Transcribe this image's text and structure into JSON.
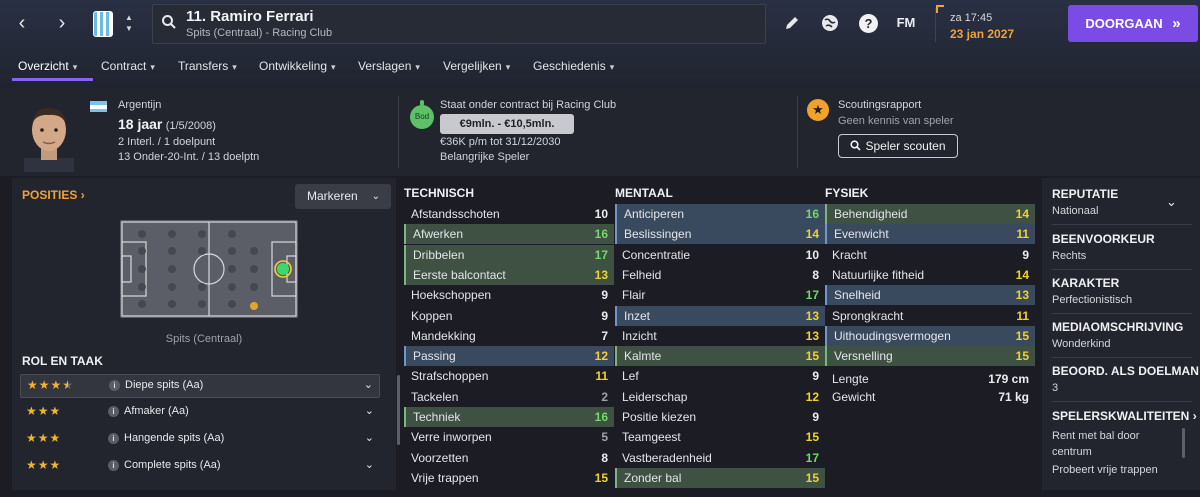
{
  "player": {
    "name": "11. Ramiro Ferrari",
    "subtitle": "Spits (Centraal) - Racing Club"
  },
  "header": {
    "time": "za 17:45",
    "date": "23 jan 2027",
    "continue_label": "DOORGAAN",
    "continue_icon": "»",
    "fm_label": "FM",
    "help_label": "?"
  },
  "tabs": [
    {
      "label": "Overzicht"
    },
    {
      "label": "Contract"
    },
    {
      "label": "Transfers"
    },
    {
      "label": "Ontwikkeling"
    },
    {
      "label": "Verslagen"
    },
    {
      "label": "Vergelijken"
    },
    {
      "label": "Geschiedenis"
    }
  ],
  "bio": {
    "nationality": "Argentijn",
    "age": "18 jaar",
    "dob": "(1/5/2008)",
    "caps": "2 Interl. / 1 doelpunt",
    "youth_caps": "13 Onder-20-Int. / 13 doelptn"
  },
  "contract": {
    "title": "Staat onder contract bij Racing Club",
    "bid_label": "Bod",
    "value_range": "€9mln. - €10,5mln.",
    "wage": "€36K p/m tot 31/12/2030",
    "status": "Belangrijke Speler"
  },
  "scouting": {
    "title": "Scoutingsrapport",
    "subtitle": "Geen kennis van speler",
    "button": "Speler scouten"
  },
  "positions": {
    "title": "POSITIES",
    "title_chevron": "›",
    "marker_label": "Markeren",
    "position_label": "Spits (Centraal)"
  },
  "roles": {
    "title": "ROL EN TAAK",
    "info_glyph": "i",
    "chevron": "⌄",
    "items": [
      {
        "name": "Diepe spits (Aa)",
        "stars": 3.5
      },
      {
        "name": "Afmaker (Aa)",
        "stars": 3
      },
      {
        "name": "Hangende spits (Aa)",
        "stars": 3
      },
      {
        "name": "Complete spits (Aa)",
        "stars": 3
      }
    ]
  },
  "technical": {
    "title": "TECHNISCH",
    "rows": [
      {
        "name": "Afstandsschoten",
        "value": "10",
        "hl": ""
      },
      {
        "name": "Afwerken",
        "value": "16",
        "hl": "green"
      },
      {
        "name": "Dribbelen",
        "value": "17",
        "hl": "green"
      },
      {
        "name": "Eerste balcontact",
        "value": "13",
        "hl": "green"
      },
      {
        "name": "Hoekschoppen",
        "value": "9",
        "hl": ""
      },
      {
        "name": "Koppen",
        "value": "9",
        "hl": ""
      },
      {
        "name": "Mandekking",
        "value": "7",
        "hl": ""
      },
      {
        "name": "Passing",
        "value": "12",
        "hl": "blue"
      },
      {
        "name": "Strafschoppen",
        "value": "11",
        "hl": ""
      },
      {
        "name": "Tackelen",
        "value": "2",
        "hl": ""
      },
      {
        "name": "Techniek",
        "value": "16",
        "hl": "green"
      },
      {
        "name": "Verre inworpen",
        "value": "5",
        "hl": ""
      },
      {
        "name": "Voorzetten",
        "value": "8",
        "hl": ""
      },
      {
        "name": "Vrije trappen",
        "value": "15",
        "hl": ""
      }
    ]
  },
  "mental": {
    "title": "MENTAAL",
    "rows": [
      {
        "name": "Anticiperen",
        "value": "16",
        "hl": "blue"
      },
      {
        "name": "Beslissingen",
        "value": "14",
        "hl": "blue"
      },
      {
        "name": "Concentratie",
        "value": "10",
        "hl": ""
      },
      {
        "name": "Felheid",
        "value": "8",
        "hl": ""
      },
      {
        "name": "Flair",
        "value": "17",
        "hl": ""
      },
      {
        "name": "Inzet",
        "value": "13",
        "hl": "blue"
      },
      {
        "name": "Inzicht",
        "value": "13",
        "hl": ""
      },
      {
        "name": "Kalmte",
        "value": "15",
        "hl": "green"
      },
      {
        "name": "Lef",
        "value": "9",
        "hl": ""
      },
      {
        "name": "Leiderschap",
        "value": "12",
        "hl": ""
      },
      {
        "name": "Positie kiezen",
        "value": "9",
        "hl": ""
      },
      {
        "name": "Teamgeest",
        "value": "15",
        "hl": ""
      },
      {
        "name": "Vastberadenheid",
        "value": "17",
        "hl": ""
      },
      {
        "name": "Zonder bal",
        "value": "15",
        "hl": "green"
      }
    ]
  },
  "physical": {
    "title": "FYSIEK",
    "rows": [
      {
        "name": "Behendigheid",
        "value": "14",
        "hl": "green"
      },
      {
        "name": "Evenwicht",
        "value": "11",
        "hl": "blue"
      },
      {
        "name": "Kracht",
        "value": "9",
        "hl": ""
      },
      {
        "name": "Natuurlijke fitheid",
        "value": "14",
        "hl": ""
      },
      {
        "name": "Snelheid",
        "value": "13",
        "hl": "blue"
      },
      {
        "name": "Sprongkracht",
        "value": "11",
        "hl": ""
      },
      {
        "name": "Uithoudingsvermogen",
        "value": "15",
        "hl": "blue"
      },
      {
        "name": "Versnelling",
        "value": "15",
        "hl": "green"
      }
    ],
    "length_label": "Lengte",
    "length_value": "179 cm",
    "weight_label": "Gewicht",
    "weight_value": "71 kg"
  },
  "side": {
    "rep_title": "REPUTATIE",
    "rep_value": "Nationaal",
    "foot_title": "BEENVOORKEUR",
    "foot_value": "Rechts",
    "char_title": "KARAKTER",
    "char_value": "Perfectionistisch",
    "media_title": "MEDIAOMSCHRIJVING",
    "media_value": "Wonderkind",
    "gk_title": "BEOORD. ALS DOELMAN",
    "gk_value": "3",
    "qual_title": "SPELERSKWALITEITEN",
    "qual_1a": "Rent met bal door",
    "qual_1b": "centrum",
    "qual_2": "Probeert vrije trappen"
  },
  "colors": {
    "accent": "#7b4be6",
    "orange": "#f0a13a",
    "attr_green": "#74d96b",
    "attr_yellow": "#f2d12e"
  }
}
